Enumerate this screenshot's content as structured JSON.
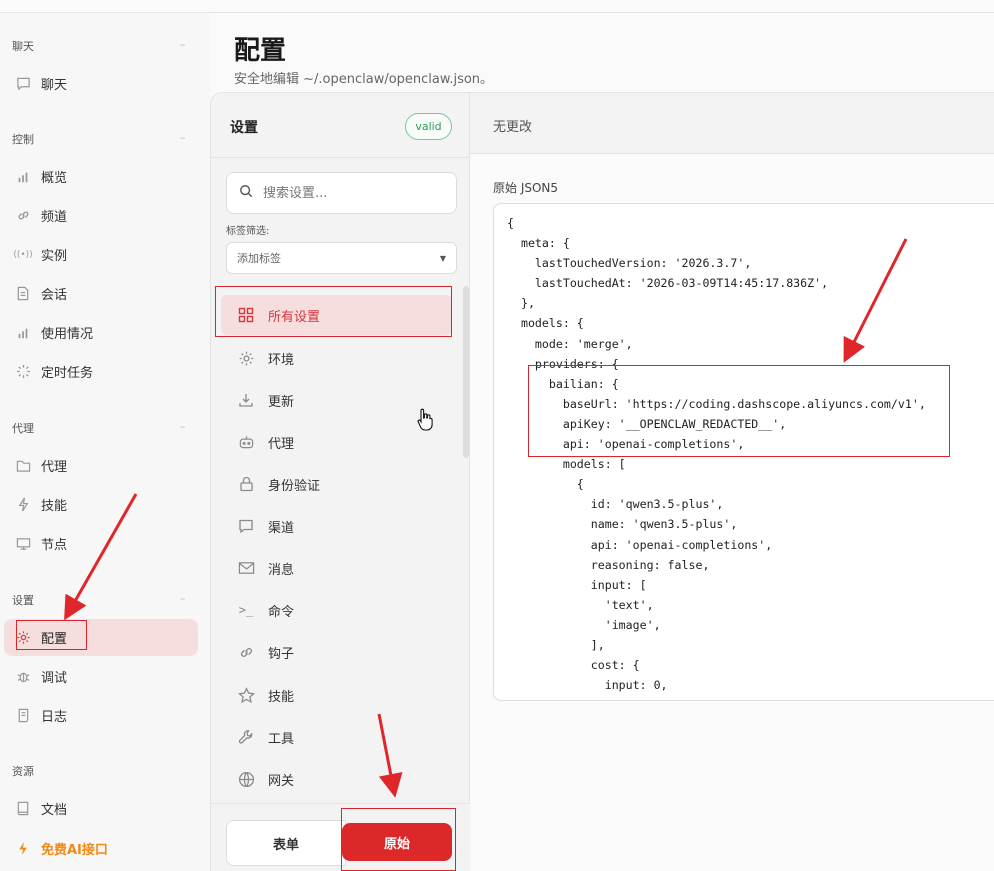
{
  "page": {
    "title": "配置",
    "subtitle": "安全地编辑 ~/.openclaw/openclaw.json。"
  },
  "nav": {
    "groups": [
      {
        "label": "聊天",
        "collapse": "–"
      },
      {
        "label": "控制",
        "collapse": "–"
      },
      {
        "label": "代理",
        "collapse": "–"
      },
      {
        "label": "设置",
        "collapse": "–"
      },
      {
        "label": "资源"
      }
    ],
    "items": [
      {
        "label": "聊天",
        "icon": "chat-icon"
      },
      {
        "label": "概览",
        "icon": "bar-chart-icon"
      },
      {
        "label": "频道",
        "icon": "link-icon"
      },
      {
        "label": "实例",
        "icon": "broadcast-icon"
      },
      {
        "label": "会话",
        "icon": "document-icon"
      },
      {
        "label": "使用情况",
        "icon": "bar-chart-icon"
      },
      {
        "label": "定时任务",
        "icon": "loader-icon"
      },
      {
        "label": "代理",
        "icon": "folder-icon"
      },
      {
        "label": "技能",
        "icon": "lightning-icon"
      },
      {
        "label": "节点",
        "icon": "monitor-icon"
      },
      {
        "label": "配置",
        "icon": "gear-icon",
        "active": true
      },
      {
        "label": "调试",
        "icon": "bug-icon"
      },
      {
        "label": "日志",
        "icon": "scroll-icon"
      },
      {
        "label": "文档",
        "icon": "book-icon"
      },
      {
        "label": "免费AI接口",
        "icon": "lightning-icon",
        "accent": "#f08a16"
      }
    ]
  },
  "settings": {
    "title": "设置",
    "badge": "valid",
    "search_placeholder": "搜索设置...",
    "tag_filter_label": "标签筛选:",
    "tag_placeholder": "添加标签",
    "items": [
      {
        "label": "所有设置",
        "icon": "grid-icon",
        "active": true
      },
      {
        "label": "环境",
        "icon": "gear-icon"
      },
      {
        "label": "更新",
        "icon": "download-icon"
      },
      {
        "label": "代理",
        "icon": "robot-icon"
      },
      {
        "label": "身份验证",
        "icon": "lock-icon"
      },
      {
        "label": "渠道",
        "icon": "chat-icon"
      },
      {
        "label": "消息",
        "icon": "mail-icon"
      },
      {
        "label": "命令",
        "icon": "terminal-icon"
      },
      {
        "label": "钩子",
        "icon": "link-icon"
      },
      {
        "label": "技能",
        "icon": "star-icon"
      },
      {
        "label": "工具",
        "icon": "wrench-icon"
      },
      {
        "label": "网关",
        "icon": "globe-icon"
      }
    ],
    "mode_buttons": {
      "form": "表单",
      "raw": "原始"
    }
  },
  "editor": {
    "status": "无更改",
    "label": "原始 JSON5",
    "lines": [
      "{",
      "  meta: {",
      "    lastTouchedVersion: '2026.3.7',",
      "    lastTouchedAt: '2026-03-09T14:45:17.836Z',",
      "  },",
      "  models: {",
      "    mode: 'merge',",
      "    providers: {",
      "      bailian: {",
      "        baseUrl: 'https://coding.dashscope.aliyuncs.com/v1',",
      "        apiKey: '__OPENCLAW_REDACTED__',",
      "        api: 'openai-completions',",
      "        models: [",
      "          {",
      "            id: 'qwen3.5-plus',",
      "            name: 'qwen3.5-plus',",
      "            api: 'openai-completions',",
      "            reasoning: false,",
      "            input: [",
      "              'text',",
      "              'image',",
      "            ],",
      "            cost: {",
      "              input: 0,"
    ]
  },
  "colors": {
    "accent": "#dc2828",
    "active_bg": "#f6dedf",
    "annotation": "#d9252b",
    "valid": "#2e9a5a"
  }
}
